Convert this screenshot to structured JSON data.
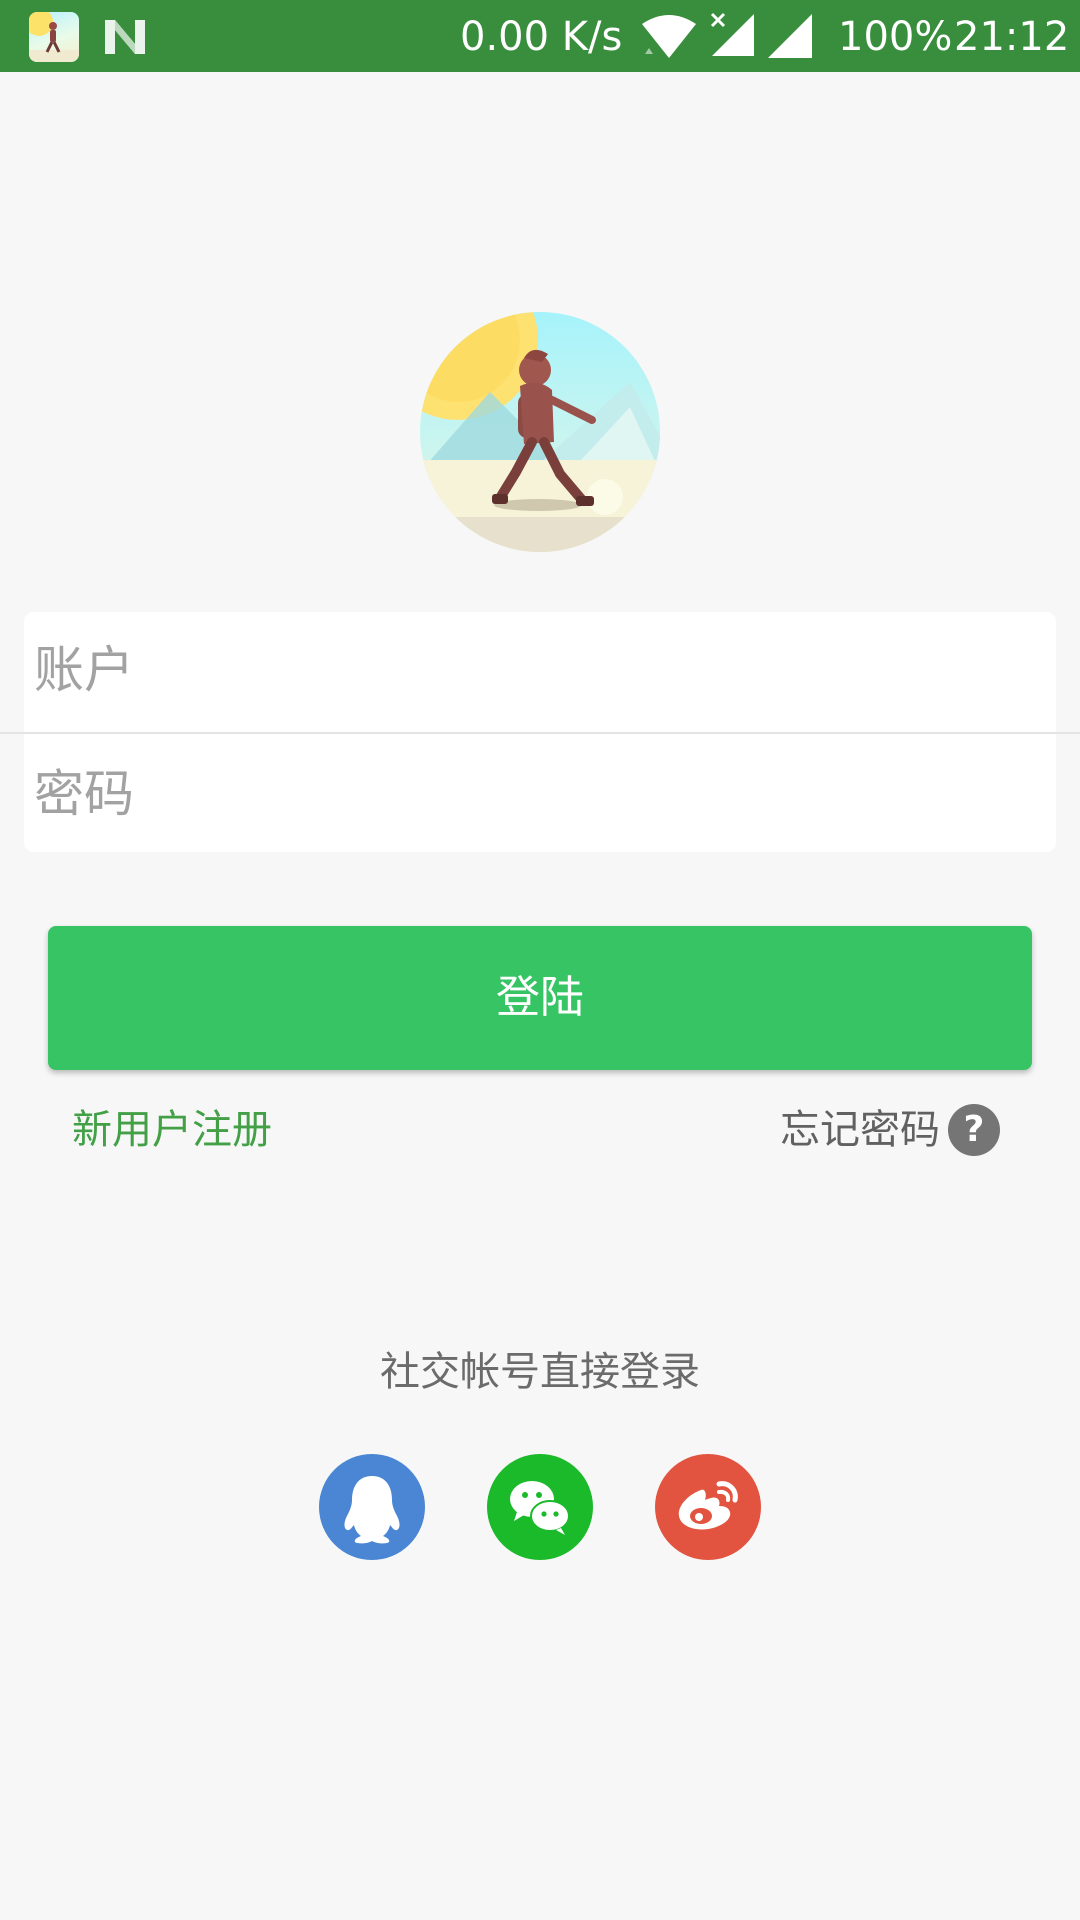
{
  "status_bar": {
    "network_speed": "0.00 K/s",
    "battery": "100%",
    "time": "21:12",
    "icons": [
      "app-icon",
      "n-notification-icon",
      "wifi-icon",
      "no-data-signal-icon",
      "cell-signal-icon"
    ]
  },
  "login_form": {
    "account_placeholder": "账户",
    "password_placeholder": "密码",
    "login_button_label": "登陆"
  },
  "links": {
    "register_label": "新用户注册",
    "forgot_password_label": "忘记密码",
    "help_glyph": "?"
  },
  "social": {
    "title": "社交帐号直接登录",
    "providers": [
      {
        "icon": "qq-icon",
        "color": "#4a86d3"
      },
      {
        "icon": "wechat-icon",
        "color": "#1aba2b"
      },
      {
        "icon": "weibo-icon",
        "color": "#e2543f"
      }
    ]
  },
  "colors": {
    "status_bar": "#388e3c",
    "primary_button": "#36c464",
    "register_link": "#43a047",
    "background": "#f7f7f7"
  }
}
